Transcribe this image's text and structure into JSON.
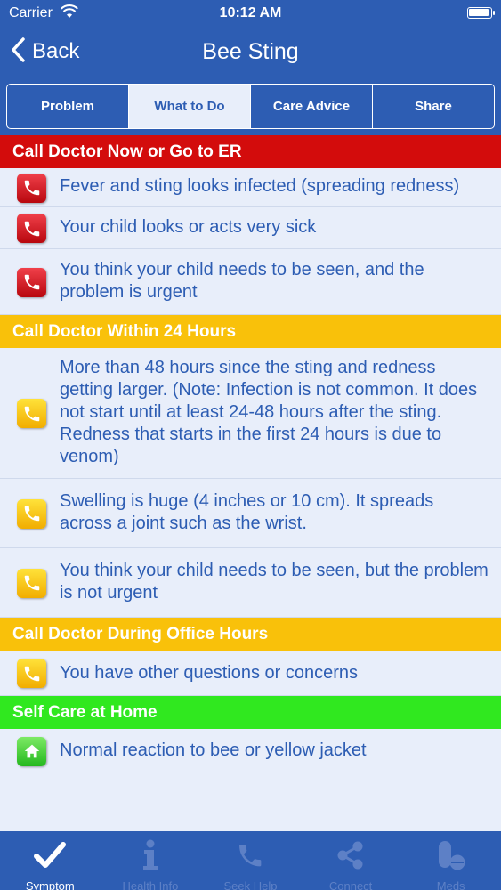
{
  "status_bar": {
    "carrier": "Carrier",
    "time": "10:12 AM"
  },
  "nav": {
    "back_label": "Back",
    "title": "Bee Sting"
  },
  "tabs": [
    {
      "label": "Problem",
      "active": false
    },
    {
      "label": "What to Do",
      "active": true
    },
    {
      "label": "Care Advice",
      "active": false
    },
    {
      "label": "Share",
      "active": false
    }
  ],
  "sections": [
    {
      "title": "Call Doctor Now or Go to ER",
      "color": "#d30c0c",
      "icon": "phone-icon",
      "items": [
        "Fever and sting looks infected (spreading redness)",
        "Your child looks or acts very sick",
        "You think your child needs to be seen, and the problem is urgent"
      ]
    },
    {
      "title": "Call Doctor Within 24 Hours",
      "color": "#f9c10a",
      "icon": "phone-icon",
      "items": [
        "More than 48 hours since the sting and redness getting larger. (Note: Infection is not common. It does not start until at least 24-48 hours after the sting. Redness that starts in the first 24 hours is due to venom)",
        "Swelling is huge (4 inches or 10 cm). It spreads across a joint such as the wrist.",
        "You think your child needs to be seen, but the problem is not urgent"
      ]
    },
    {
      "title": "Call Doctor During Office Hours",
      "color": "#f9c10a",
      "icon": "phone-icon",
      "items": [
        "You have other questions or concerns"
      ]
    },
    {
      "title": "Self Care at Home",
      "color": "#30e81f",
      "icon": "home-icon",
      "items": [
        "Normal reaction to bee or yellow jacket"
      ]
    }
  ],
  "tab_bar": [
    {
      "label": "Symptom",
      "icon": "checkmark-icon",
      "active": true
    },
    {
      "label": "Health Info",
      "icon": "info-icon",
      "active": false
    },
    {
      "label": "Seek Help",
      "icon": "phone-icon",
      "active": false
    },
    {
      "label": "Connect",
      "icon": "share-icon",
      "active": false
    },
    {
      "label": "Meds",
      "icon": "pills-icon",
      "active": false
    }
  ]
}
